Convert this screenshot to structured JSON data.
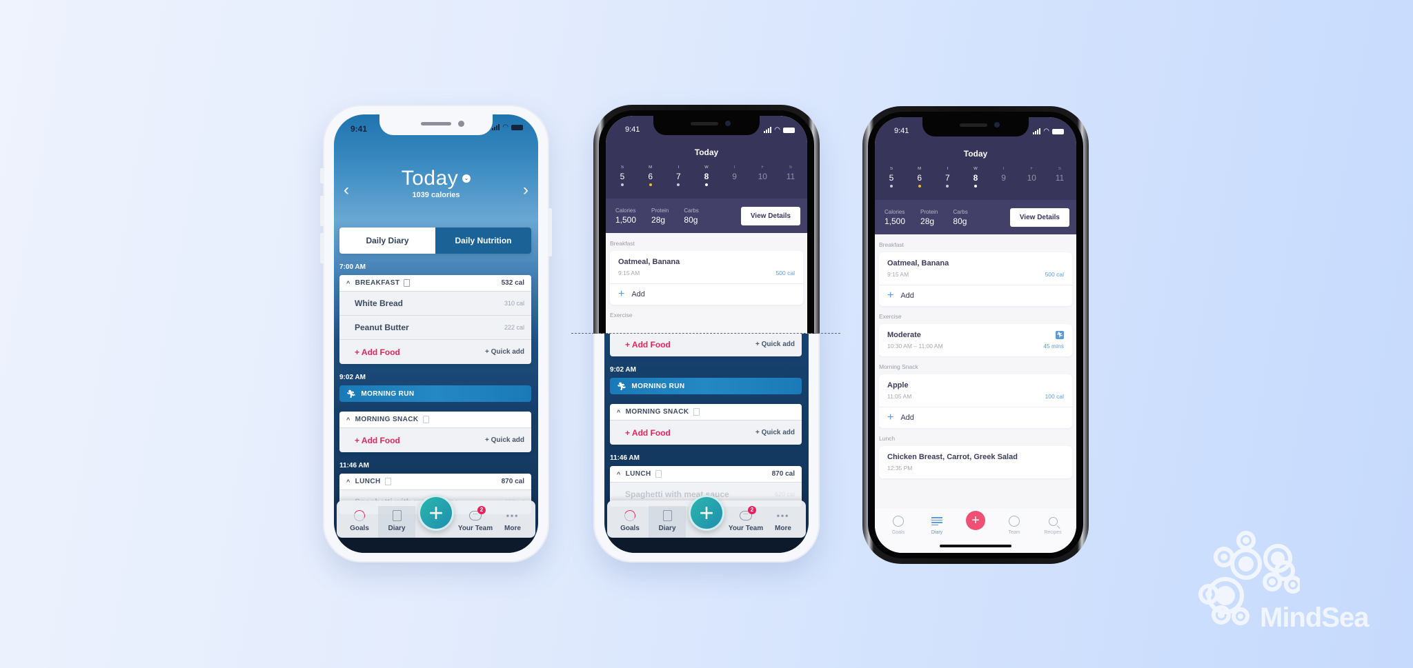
{
  "status_bar": {
    "time": "9:41"
  },
  "phone1": {
    "header": {
      "title": "Today",
      "subtitle": "1039 calories",
      "prev": "‹",
      "next": "›",
      "dropdown_icon": "⌄"
    },
    "segments": {
      "left": "Daily Diary",
      "right": "Daily Nutrition"
    },
    "diary": [
      {
        "time": "7:00 AM",
        "meal": "BREAKFAST",
        "meal_cal": "532 cal",
        "items": [
          {
            "name": "White Bread",
            "cal": "310 cal"
          },
          {
            "name": "Peanut Butter",
            "cal": "222 cal"
          }
        ],
        "add_food": "+ Add Food",
        "quick_add": "+ Quick add"
      },
      {
        "time": "9:02 AM",
        "exercise": "MORNING RUN"
      },
      {
        "meal": "MORNING SNACK",
        "add_food": "+ Add Food",
        "quick_add": "+ Quick add"
      },
      {
        "time": "11:46 AM",
        "meal": "LUNCH",
        "meal_cal": "870 cal",
        "items": [
          {
            "name": "Spaghetti with meat sauce",
            "cal": "620 cal"
          }
        ]
      }
    ],
    "tabbar": {
      "goals": "Goals",
      "diary": "Diary",
      "team": "Your Team",
      "team_badge": "2",
      "more": "More",
      "add": "+"
    }
  },
  "phone2": {
    "top_sections": [
      "Breakfast",
      "Exercise"
    ],
    "bottom_labels": {
      "time1": "9:02 AM",
      "time2": "11:46 AM"
    }
  },
  "ios": {
    "title": "Today",
    "week": [
      {
        "l": "S",
        "n": "5",
        "dot": "#c9c9d6"
      },
      {
        "l": "M",
        "n": "6",
        "dot": "#f2b92b"
      },
      {
        "l": "T",
        "n": "7",
        "dot": "#c9c9d6"
      },
      {
        "l": "W",
        "n": "8",
        "dot": "#ffffff"
      },
      {
        "l": "T",
        "n": "9",
        "dot": ""
      },
      {
        "l": "F",
        "n": "10",
        "dot": ""
      },
      {
        "l": "S",
        "n": "11",
        "dot": ""
      }
    ],
    "stats": [
      {
        "label": "Calories",
        "value": "1,500"
      },
      {
        "label": "Protein",
        "value": "28g"
      },
      {
        "label": "Carbs",
        "value": "80g"
      }
    ],
    "view_details": "View Details",
    "sections": {
      "breakfast": {
        "label": "Breakfast",
        "name": "Oatmeal, Banana",
        "time": "9:15 AM",
        "cal": "500 cal",
        "add": "Add"
      },
      "exercise": {
        "label": "Exercise",
        "name": "Moderate",
        "time": "10:30 AM – 11:00 AM",
        "dur": "45 mins"
      },
      "snack": {
        "label": "Morning Snack",
        "name": "Apple",
        "time": "11:05 AM",
        "cal": "100 cal",
        "add": "Add"
      },
      "lunch": {
        "label": "Lunch",
        "name": "Chicken Breast, Carrot, Greek Salad",
        "time": "12:35 PM"
      }
    },
    "tabbar": {
      "goals": "Goals",
      "diary": "Diary",
      "team": "Team",
      "recipes": "Recipes",
      "add": "+"
    }
  },
  "brand": {
    "name": "MindSea"
  },
  "colors": {
    "accent_pink": "#e6245a",
    "ios_purple": "#37355a",
    "ios_blue": "#5a9ad6",
    "teal": "#2bb5ad"
  }
}
